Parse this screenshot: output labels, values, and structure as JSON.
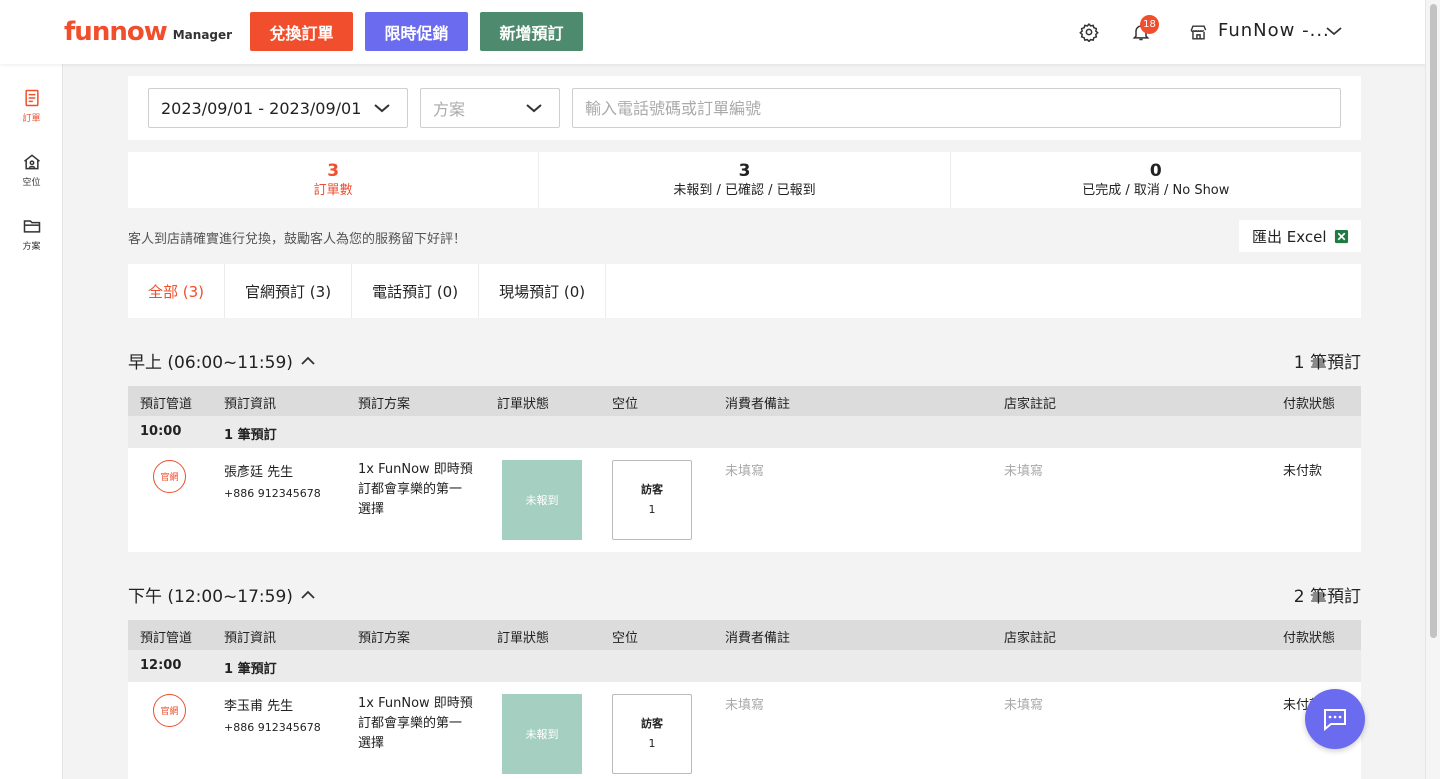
{
  "header": {
    "logo": "funnow",
    "logo_sub": "Manager",
    "buttons": {
      "exchange": "兌換訂單",
      "promo": "限時促銷",
      "new_booking": "新增預訂"
    },
    "notification_count": "18",
    "store_name": "FunNow -..."
  },
  "sidebar": {
    "items": [
      {
        "label": "訂單",
        "icon": "order-icon"
      },
      {
        "label": "空位",
        "icon": "home-icon"
      },
      {
        "label": "方案",
        "icon": "folder-icon"
      }
    ]
  },
  "filters": {
    "date_range": "2023/09/01 - 2023/09/01",
    "plan_placeholder": "方案",
    "search_placeholder": "輸入電話號碼或訂單編號"
  },
  "stats": [
    {
      "value": "3",
      "label": "訂單數"
    },
    {
      "value": "3",
      "label": "未報到 / 已確認 / 已報到"
    },
    {
      "value": "0",
      "label": "已完成 / 取消 / No Show"
    }
  ],
  "hint": "客人到店請確實進行兌換，鼓勵客人為您的服務留下好評！",
  "export_label": "匯出 Excel",
  "tabs": [
    "全部 (3)",
    "官網預訂 (3)",
    "電話預訂 (0)",
    "現場預訂 (0)"
  ],
  "table_headers": [
    "預訂管道",
    "預訂資訊",
    "預訂方案",
    "訂單狀態",
    "空位",
    "消費者備註",
    "店家註記",
    "付款狀態"
  ],
  "sections": [
    {
      "title": "早上 (06:00~11:59)",
      "count": "1 筆預訂",
      "slot_time": "10:00",
      "slot_count": "1 筆預訂",
      "booking": {
        "channel": "官網",
        "name": "張彥廷 先生",
        "phone": "+886 912345678",
        "plan": "1x FunNow 即時預訂都會享樂的第一選擇",
        "status": "未報到",
        "seat_label": "訪客",
        "seat_count": "1",
        "customer_note": "未填寫",
        "store_note": "未填寫",
        "payment": "未付款"
      }
    },
    {
      "title": "下午 (12:00~17:59)",
      "count": "2 筆預訂",
      "slot_time": "12:00",
      "slot_count": "1 筆預訂",
      "booking": {
        "channel": "官網",
        "name": "李玉甫 先生",
        "phone": "+886 912345678",
        "plan": "1x FunNow 即時預訂都會享樂的第一選擇",
        "status": "未報到",
        "seat_label": "訪客",
        "seat_count": "1",
        "customer_note": "未填寫",
        "store_note": "未填寫",
        "payment": "未付款"
      }
    }
  ],
  "colors": {
    "brand": "#f04e2d",
    "purple": "#6b6bef",
    "green": "#4e8a6e",
    "status_pending": "#a5cfc0"
  }
}
